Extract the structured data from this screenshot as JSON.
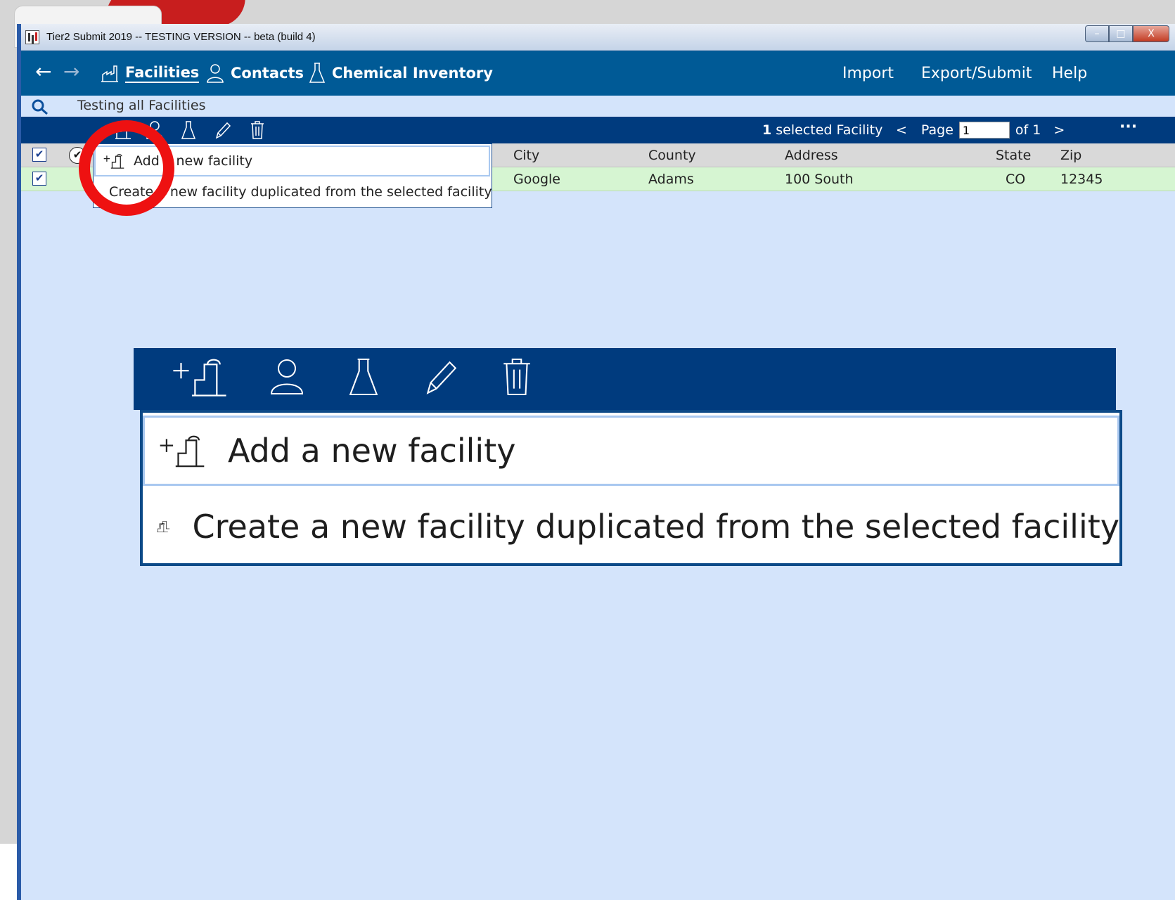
{
  "window": {
    "title": "Tier2 Submit 2019 -- TESTING VERSION -- beta (build 4)",
    "controls": {
      "minimize": "–",
      "maximize": "□",
      "close": "X"
    }
  },
  "nav": {
    "back": "←",
    "forward": "→",
    "items": [
      {
        "label": "Facilities",
        "icon": "factory-icon",
        "active": true
      },
      {
        "label": "Contacts",
        "icon": "person-icon"
      },
      {
        "label": "Chemical Inventory",
        "icon": "flask-icon"
      }
    ],
    "right": [
      "Import",
      "Export/Submit",
      "Help"
    ]
  },
  "search": {
    "text": "Testing all Facilities",
    "icon": "search-icon"
  },
  "toolbar": {
    "icons": [
      "add-facility-icon",
      "person-icon",
      "flask-icon",
      "pencil-icon",
      "trash-icon"
    ],
    "selected_count": "1",
    "selected_label": " selected Facility",
    "prev": "<",
    "page_label": "Page",
    "page_value": "1",
    "of_label": "of 1",
    "next": ">",
    "more": "···"
  },
  "grid": {
    "columns": [
      "City",
      "County",
      "Address",
      "State",
      "Zip"
    ],
    "rows": [
      {
        "checked": true,
        "city": "Google",
        "county": "Adams",
        "address": "100 South",
        "state": "CO",
        "zip": "12345"
      }
    ]
  },
  "menu": {
    "items": [
      {
        "label": "Add a new facility",
        "icon": "add-facility-icon"
      },
      {
        "label": "Create a new facility duplicated from the selected facility",
        "icon": "duplicate-facility-icon"
      }
    ]
  },
  "colors": {
    "nav_bg": "#005a96",
    "toolbar_bg": "#003b7e",
    "content_bg": "#d4e4fb",
    "row_selected": "#d6f5d2",
    "highlight_ring": "#ee1111"
  }
}
